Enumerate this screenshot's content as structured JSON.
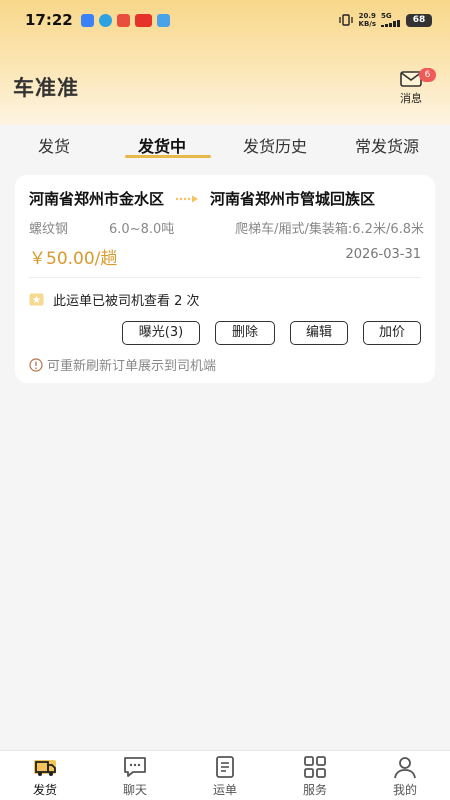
{
  "status_bar": {
    "time": "17:22",
    "net_speed_value": "20.9",
    "net_speed_unit": "KB/s",
    "network": "5G",
    "battery": "68"
  },
  "header": {
    "app_title": "车准准",
    "message_label": "消息",
    "message_badge": "6"
  },
  "tabs": [
    {
      "label": "发货",
      "active": false
    },
    {
      "label": "发货中",
      "active": true
    },
    {
      "label": "发货历史",
      "active": false
    },
    {
      "label": "常发货源",
      "active": false
    }
  ],
  "order_card": {
    "origin": "河南省郑州市金水区",
    "destination": "河南省郑州市管城回族区",
    "cargo_name": "螺纹钢",
    "cargo_weight": "6.0~8.0吨",
    "truck_requirements": "爬梯车/厢式/集装箱:6.2米/6.8米",
    "price": "￥50.00/趟",
    "date": "2026-03-31",
    "view_notice": "此运单已被司机查看 2 次",
    "buttons": {
      "expose": "曝光(3)",
      "delete": "删除",
      "edit": "编辑",
      "add_price": "加价"
    },
    "tip": "可重新刷新订单展示到司机端"
  },
  "bottom_nav": [
    {
      "label": "发货",
      "icon": "truck-icon",
      "active": true
    },
    {
      "label": "聊天",
      "icon": "chat-icon",
      "active": false
    },
    {
      "label": "运单",
      "icon": "document-icon",
      "active": false
    },
    {
      "label": "服务",
      "icon": "grid-icon",
      "active": false
    },
    {
      "label": "我的",
      "icon": "user-icon",
      "active": false
    }
  ],
  "colors": {
    "accent": "#e8b94a",
    "price": "#d99a2c",
    "badge": "#f05a57",
    "header_top": "#f7d78a"
  }
}
